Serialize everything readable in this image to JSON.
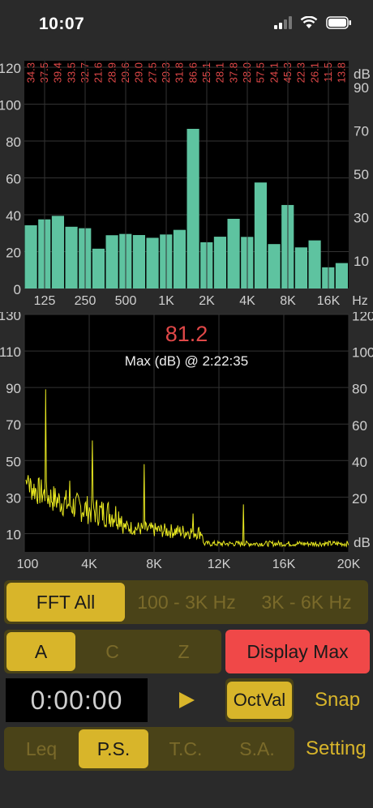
{
  "status_bar": {
    "time": "10:07"
  },
  "chart_data": [
    {
      "type": "bar",
      "title": "",
      "xlabel": "Hz",
      "ylabel_right": "dB",
      "ylim_left": [
        0,
        120
      ],
      "ylim_right": [
        0,
        100
      ],
      "left_ticks": [
        "0",
        "20",
        "40",
        "60",
        "80",
        "100",
        "120"
      ],
      "right_ticks": [
        "10",
        "30",
        "50",
        "70",
        "90"
      ],
      "x_tick_labels": [
        "125",
        "250",
        "500",
        "1K",
        "2K",
        "4K",
        "8K",
        "16K"
      ],
      "x_unit": "Hz",
      "right_unit": "dB",
      "bar_labels": [
        "34.3",
        "37.5",
        "39.4",
        "33.5",
        "32.7",
        "21.6",
        "28.9",
        "29.6",
        "29.0",
        "27.5",
        "29.3",
        "31.8",
        "86.6",
        "25.1",
        "28.1",
        "37.8",
        "28.0",
        "57.5",
        "24.1",
        "45.3",
        "22.3",
        "26.1",
        "11.5",
        "13.8"
      ],
      "values": [
        34.3,
        37.5,
        39.4,
        33.5,
        32.7,
        21.6,
        28.9,
        29.6,
        29.0,
        27.5,
        29.3,
        31.8,
        86.6,
        25.1,
        28.1,
        37.8,
        28.0,
        57.5,
        24.1,
        45.3,
        22.3,
        26.1,
        11.5,
        13.8
      ],
      "bar_color": "#5ec3a0",
      "label_color": "#e04848",
      "grid": true
    },
    {
      "type": "line",
      "title": "81.2",
      "subtitle": "Max (dB) @ 2:22:35",
      "title_color": "#e04848",
      "line_color": "#e8e820",
      "xlim": [
        0,
        20000
      ],
      "ylim_left": [
        0,
        130
      ],
      "ylim_right": [
        0,
        130
      ],
      "x_tick_labels": [
        "100",
        "4K",
        "8K",
        "12K",
        "16K",
        "20K"
      ],
      "left_ticks": [
        "10",
        "30",
        "50",
        "70",
        "90",
        "110",
        "130"
      ],
      "right_ticks": [
        "20",
        "40",
        "60",
        "80",
        "100",
        "120"
      ],
      "right_unit": "dB",
      "peaks": [
        {
          "x": 1300,
          "y": 89
        },
        {
          "x": 2800,
          "y": 39
        },
        {
          "x": 4200,
          "y": 61
        },
        {
          "x": 7400,
          "y": 48
        },
        {
          "x": 5200,
          "y": 27
        },
        {
          "x": 10400,
          "y": 21
        },
        {
          "x": 13500,
          "y": 26
        }
      ],
      "grid": true
    }
  ],
  "controls": {
    "mode_tabs": [
      "FFT All",
      "100 - 3K Hz",
      "3K - 6K Hz"
    ],
    "weighting_tabs": [
      "A",
      "C",
      "Z"
    ],
    "display_max": "Display Max",
    "timer": "0:00:00",
    "octval": "OctVal",
    "snap": "Snap",
    "bottom_tabs": [
      "Leq",
      "P.S.",
      "T.C.",
      "S.A."
    ],
    "setting": "Setting"
  }
}
